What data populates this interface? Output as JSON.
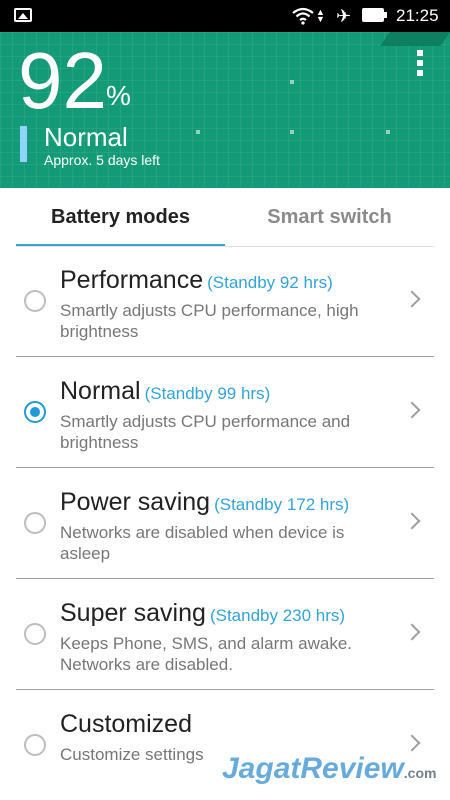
{
  "statusbar": {
    "time": "21:25"
  },
  "header": {
    "percent": "92",
    "percent_sign": "%",
    "mode": "Normal",
    "time_left": "Approx. 5 days left",
    "level_fraction": 0.92
  },
  "tabs": [
    {
      "label": "Battery modes",
      "active": true
    },
    {
      "label": "Smart switch",
      "active": false
    }
  ],
  "modes": [
    {
      "title": "Performance",
      "standby": "(Standby 92 hrs)",
      "desc": "Smartly adjusts CPU performance, high brightness",
      "selected": false
    },
    {
      "title": "Normal",
      "standby": "(Standby 99 hrs)",
      "desc": "Smartly adjusts CPU performance and brightness",
      "selected": true
    },
    {
      "title": "Power saving",
      "standby": "(Standby 172 hrs)",
      "desc": "Networks are disabled when device is asleep",
      "selected": false
    },
    {
      "title": "Super saving",
      "standby": "(Standby 230 hrs)",
      "desc": "Keeps Phone, SMS, and alarm awake. Networks are disabled.",
      "selected": false
    },
    {
      "title": "Customized",
      "standby": "",
      "desc": "Customize settings",
      "selected": false
    }
  ],
  "watermark": {
    "main": "JagatReview",
    "suffix": ".com"
  },
  "colors": {
    "header_bg": "#139a76",
    "accent": "#33a3d8",
    "radio_selected": "#1e9bd7"
  }
}
